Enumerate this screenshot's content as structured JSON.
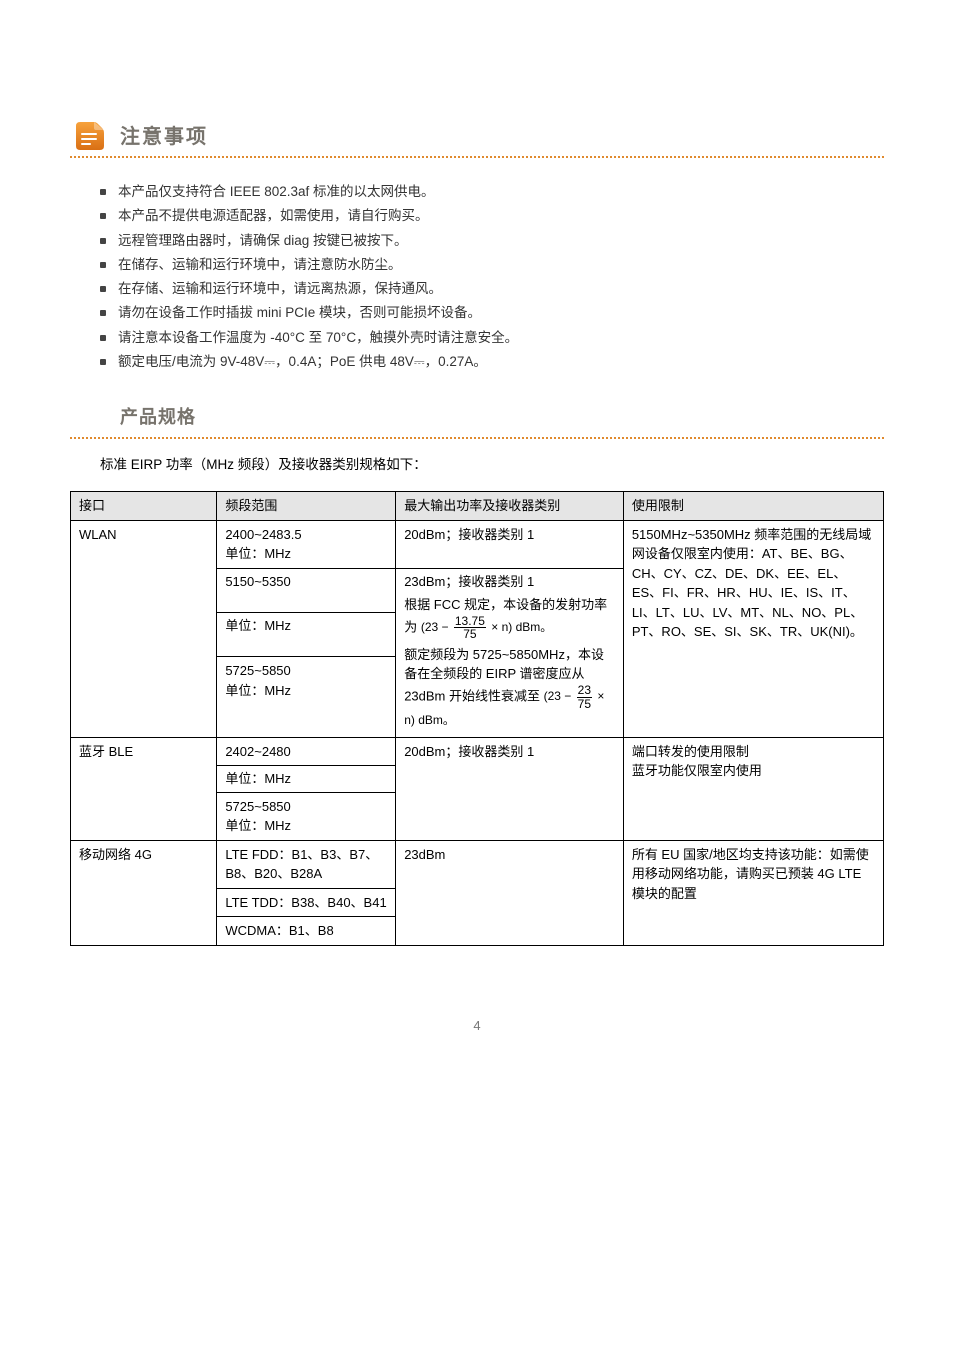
{
  "section_note": {
    "title": "注意事项",
    "bullets": [
      "本产品仅支持符合 IEEE 802.3af 标准的以太网供电。",
      "本产品不提供电源适配器，如需使用，请自行购买。",
      "远程管理路由器时，请确保 diag 按键已被按下。",
      "在储存、运输和运行环境中，请注意防水防尘。",
      "在存储、运输和运行环境中，请远离热源，保持通风。",
      "请勿在设备工作时插拔 mini PCIe 模块，否则可能损坏设备。",
      "请注意本设备工作温度为 -40°C 至 70°C，触摸外壳时请注意安全。",
      "额定电压/电流为 9V-48V⎓，0.4A；PoE 供电 48V⎓，0.27A。"
    ]
  },
  "section_spec": {
    "title": "产品规格",
    "desc": "标准 EIRP 功率（MHz 频段）及接收器类别规格如下：",
    "header": {
      "c1": "接口",
      "c2": "频段范围",
      "c3": "最大输出功率及接收器类别",
      "c4": "使用限制"
    },
    "rows": {
      "wlan": {
        "iface": "WLAN",
        "b24": {
          "range": "2400~2483.5",
          "power": "20dBm；接收器类别 1",
          "restrict": "5150MHz~5350MHz 频率范围的无线局域网设备仅限室内使用：AT、BE、BG、CH、CY、CZ、DE、DK、EE、EL、ES、FI、FR、HR、HU、IE、IS、IT、LI、LT、LU、LV、MT、NL、NO、PL、PT、RO、SE、SI、SK、TR、UK(NI)。"
        },
        "b51": {
          "range": "5150~5350",
          "unit": "单位：MHz"
        },
        "b57": {
          "range": "5725~5850"
        },
        "fcc_power": "23dBm；接收器类别 1",
        "fcc_line1": "根据 FCC 规定，本设备的发射功率为",
        "fcc_line2": "额定频段为 5725~5850MHz，本设备在全频段的 EIRP 谱密度应从 23dBm 开始线性衰减至"
      },
      "ble": {
        "iface": "蓝牙 BLE",
        "b1": {
          "range": "2402~2480"
        },
        "b2": {
          "range": "5725~5850",
          "unit": "单位：MHz"
        },
        "power": "20dBm；接收器类别 1",
        "restrict_line1": "端口转发的使用限制",
        "restrict_line2": "蓝牙功能仅限室内使用"
      },
      "mobile4g": {
        "iface": "移动网络 4G",
        "lte_fdd": {
          "range": "LTE FDD：B1、B3、B7、B8、B20、B28A"
        },
        "lte_tdd": {
          "range": "LTE TDD：B38、B40、B41"
        },
        "wcdma": {
          "range": "WCDMA：B1、B8"
        },
        "power": "23dBm",
        "restrict": "所有 EU 国家/地区均支持该功能：如需使用移动网络功能，请购买已预装 4G LTE 模块的配置"
      }
    }
  },
  "frac1": {
    "num": "13.75",
    "den": "75"
  },
  "frac2": {
    "num": "23",
    "den": "75"
  },
  "page_number": "4"
}
